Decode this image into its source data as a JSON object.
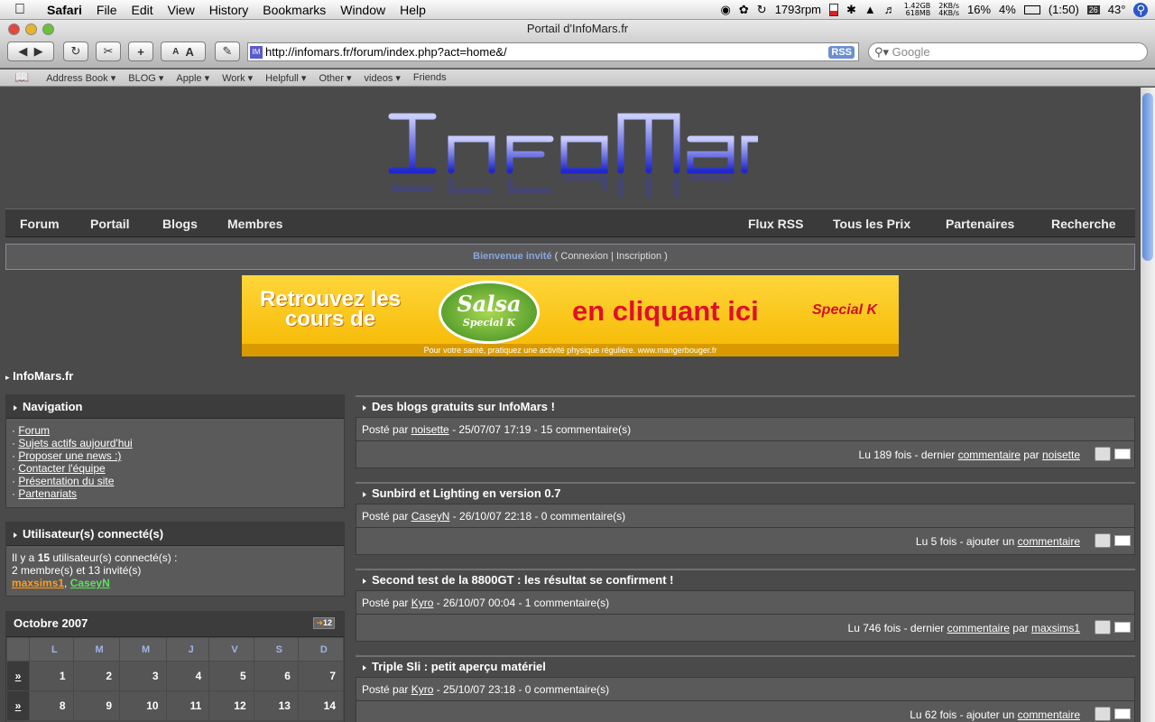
{
  "menubar": {
    "app": "Safari",
    "items": [
      "File",
      "Edit",
      "View",
      "History",
      "Bookmarks",
      "Window",
      "Help"
    ],
    "rpm": "1793rpm",
    "mem": [
      "1.42GB",
      "618MB"
    ],
    "net": [
      "2KB/s",
      "4KB/s"
    ],
    "cpu": "16%",
    "cpu2": "4%",
    "battery": "(1:50)",
    "date": "26",
    "temp": "43°"
  },
  "window": {
    "title": "Portail d'InfoMars.fr",
    "url": "http://infomars.fr/forum/index.php?act=home&/",
    "rss": "RSS",
    "search_placeholder": "Google"
  },
  "bookmarks": [
    "Address Book ▾",
    "BLOG ▾",
    "Apple ▾",
    "Work ▾",
    "Helpfull ▾",
    "Other ▾",
    "videos ▾",
    "Friends"
  ],
  "nav": {
    "left": [
      "Forum",
      "Portail",
      "Blogs",
      "Membres"
    ],
    "right": [
      "Flux RSS",
      "Tous les Prix",
      "Partenaires",
      "Recherche"
    ]
  },
  "welcome": {
    "greet": "Bienvenue invité",
    "open": " ( ",
    "login": "Connexion",
    "sep": " | ",
    "register": "Inscription",
    "close": " )"
  },
  "banner": {
    "line1": "Retrouvez les",
    "line2": "cours de",
    "salsa": "Salsa",
    "special_k": "Special K",
    "cta": "en cliquant ici",
    "footer": "Pour votre santé, pratiquez une activité physique régulière. www.mangerbouger.fr"
  },
  "site_title": "InfoMars.fr",
  "navigation": {
    "title": "Navigation",
    "links": [
      "Forum",
      "Sujets actifs aujourd'hui",
      "Proposer une news :)",
      "Contacter l'équipe",
      "Présentation du site",
      "Partenariats"
    ]
  },
  "online": {
    "title": "Utilisateur(s) connecté(s)",
    "line_pre": "Il y a ",
    "count": "15",
    "line_post": " utilisateur(s) connecté(s) :",
    "line2": "2 membre(s) et 13 invité(s)",
    "user1": "maxsims1",
    "user2": "CaseyN",
    "user1_color": "#ff9d1e",
    "user2_color": "#5fe05f"
  },
  "calendar": {
    "title": "Octobre 2007",
    "badge": "12",
    "days": [
      "L",
      "M",
      "M",
      "J",
      "V",
      "S",
      "D"
    ],
    "weeks": [
      {
        "wk": "»",
        "d": [
          "1",
          "2",
          "3",
          "4",
          "5",
          "6",
          "7"
        ]
      },
      {
        "wk": "»",
        "d": [
          "8",
          "9",
          "10",
          "11",
          "12",
          "13",
          "14"
        ]
      }
    ]
  },
  "news": [
    {
      "title": "Des blogs gratuits sur InfoMars !",
      "by": "Posté par ",
      "author": "noisette",
      "meta": " - 25/07/07 17:19 - 15 commentaire(s)",
      "reads": "Lu 189 fois - dernier ",
      "clink": "commentaire",
      "par": " par ",
      "last": "noisette"
    },
    {
      "title": "Sunbird et Lighting en version 0.7",
      "by": "Posté par ",
      "author": "CaseyN",
      "meta": " - 26/10/07 22:18 - 0 commentaire(s)",
      "reads": "Lu 5 fois - ajouter un ",
      "clink": "commentaire",
      "par": "",
      "last": ""
    },
    {
      "title": "Second test de la 8800GT : les résultat se confirment !",
      "by": "Posté par ",
      "author": "Kyro",
      "meta": " - 26/10/07 00:04 - 1 commentaire(s)",
      "reads": "Lu 746 fois - dernier ",
      "clink": "commentaire",
      "par": " par ",
      "last": "maxsims1"
    },
    {
      "title": "Triple Sli : petit aperçu matériel",
      "by": "Posté par ",
      "author": "Kyro",
      "meta": " - 25/10/07 23:18 - 0 commentaire(s)",
      "reads": "Lu 62 fois - ajouter un ",
      "clink": "commentaire",
      "par": "",
      "last": ""
    }
  ]
}
